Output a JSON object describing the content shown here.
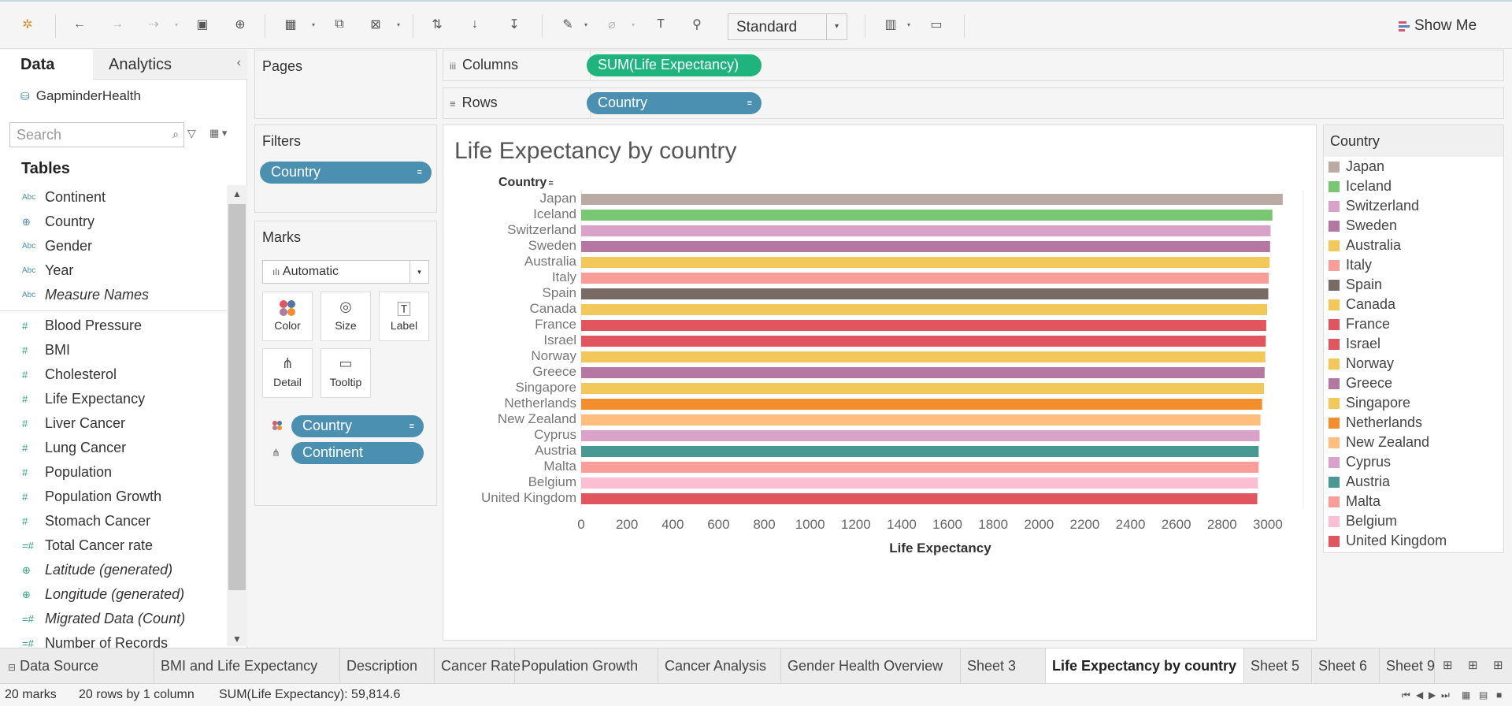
{
  "toolbar": {
    "style_select": "Standard",
    "show_me": "Show Me"
  },
  "data_pane": {
    "tab_data": "Data",
    "tab_analytics": "Analytics",
    "datasource": "GapminderHealth",
    "search_placeholder": "Search",
    "tables_heading": "Tables",
    "dimensions": [
      {
        "type": "Abc",
        "label": "Continent"
      },
      {
        "type": "geo",
        "label": "Country"
      },
      {
        "type": "Abc",
        "label": "Gender"
      },
      {
        "type": "Abc",
        "label": "Year"
      },
      {
        "type": "Abc",
        "label": "Measure Names"
      }
    ],
    "measures": [
      {
        "type": "#",
        "label": "Blood Pressure"
      },
      {
        "type": "#",
        "label": "BMI"
      },
      {
        "type": "#",
        "label": "Cholesterol"
      },
      {
        "type": "#",
        "label": "Life Expectancy"
      },
      {
        "type": "#",
        "label": "Liver Cancer"
      },
      {
        "type": "#",
        "label": "Lung Cancer"
      },
      {
        "type": "#",
        "label": "Population"
      },
      {
        "type": "#",
        "label": "Population Growth"
      },
      {
        "type": "#",
        "label": "Stomach Cancer"
      },
      {
        "type": "=#",
        "label": "Total Cancer rate"
      },
      {
        "type": "geo",
        "label": "Latitude (generated)"
      },
      {
        "type": "geo",
        "label": "Longitude (generated)"
      },
      {
        "type": "=#",
        "label": "Migrated Data (Count)"
      },
      {
        "type": "=#",
        "label": "Number of Records"
      }
    ]
  },
  "pages": {
    "title": "Pages"
  },
  "filters": {
    "title": "Filters",
    "pill": "Country"
  },
  "marks": {
    "title": "Marks",
    "type": "Automatic",
    "buttons": {
      "color": "Color",
      "size": "Size",
      "label": "Label",
      "detail": "Detail",
      "tooltip": "Tooltip"
    },
    "pills": {
      "color": "Country",
      "detail": "Continent"
    }
  },
  "shelves": {
    "columns_label": "Columns",
    "columns_pill": "SUM(Life Expectancy)",
    "rows_label": "Rows",
    "rows_pill": "Country"
  },
  "viz": {
    "title": "Life Expectancy by country",
    "row_header": "Country"
  },
  "chart_data": {
    "type": "bar",
    "orientation": "horizontal",
    "categories": [
      "Japan",
      "Iceland",
      "Switzerland",
      "Sweden",
      "Australia",
      "Italy",
      "Spain",
      "Canada",
      "France",
      "Israel",
      "Norway",
      "Greece",
      "Singapore",
      "Netherlands",
      "New Zealand",
      "Cyprus",
      "Austria",
      "Malta",
      "Belgium",
      "United Kingdom"
    ],
    "values": [
      3065,
      3020,
      3012,
      3010,
      3008,
      3004,
      3002,
      2997,
      2993,
      2991,
      2989,
      2986,
      2983,
      2975,
      2968,
      2964,
      2960,
      2960,
      2957,
      2954
    ],
    "colors": [
      "#b9aba3",
      "#79c773",
      "#d8a2c9",
      "#b377a1",
      "#f2c85b",
      "#f89d97",
      "#786b66",
      "#f2c85b",
      "#e1565e",
      "#e1565e",
      "#f2c85b",
      "#b377a1",
      "#f2c85b",
      "#f28e2b",
      "#ffbe7d",
      "#d8a2c9",
      "#499894",
      "#f89d97",
      "#fabfd2",
      "#e1565e"
    ],
    "xlabel": "Life Expectancy",
    "ylabel": "Country",
    "xlim": [
      0,
      3100
    ],
    "xticks": [
      0,
      200,
      400,
      600,
      800,
      1000,
      1200,
      1400,
      1600,
      1800,
      2000,
      2200,
      2400,
      2600,
      2800,
      3000
    ]
  },
  "legend": {
    "title": "Country",
    "items": [
      {
        "label": "Japan",
        "color": "#b9aba3"
      },
      {
        "label": "Iceland",
        "color": "#79c773"
      },
      {
        "label": "Switzerland",
        "color": "#d8a2c9"
      },
      {
        "label": "Sweden",
        "color": "#b377a1"
      },
      {
        "label": "Australia",
        "color": "#f2c85b"
      },
      {
        "label": "Italy",
        "color": "#f89d97"
      },
      {
        "label": "Spain",
        "color": "#786b66"
      },
      {
        "label": "Canada",
        "color": "#f2c85b"
      },
      {
        "label": "France",
        "color": "#e1565e"
      },
      {
        "label": "Israel",
        "color": "#e1565e"
      },
      {
        "label": "Norway",
        "color": "#f2c85b"
      },
      {
        "label": "Greece",
        "color": "#b377a1"
      },
      {
        "label": "Singapore",
        "color": "#f2c85b"
      },
      {
        "label": "Netherlands",
        "color": "#f28e2b"
      },
      {
        "label": "New Zealand",
        "color": "#ffbe7d"
      },
      {
        "label": "Cyprus",
        "color": "#d8a2c9"
      },
      {
        "label": "Austria",
        "color": "#499894"
      },
      {
        "label": "Malta",
        "color": "#f89d97"
      },
      {
        "label": "Belgium",
        "color": "#fabfd2"
      },
      {
        "label": "United Kingdom",
        "color": "#e1565e"
      }
    ]
  },
  "sheet_tabs": {
    "datasource": "Data Source",
    "tabs": [
      "BMI and Life Expectancy",
      "Description",
      "Cancer Rate",
      "Population Growth",
      "Cancer Analysis",
      "Gender Health Overview",
      "Sheet 3",
      "Life Expectancy by country",
      "Sheet 5",
      "Sheet 6",
      "Sheet 9"
    ],
    "active": "Life Expectancy by country"
  },
  "status": {
    "marks": "20 marks",
    "dims": "20 rows by 1 column",
    "sum": "SUM(Life Expectancy): 59,814.6"
  }
}
